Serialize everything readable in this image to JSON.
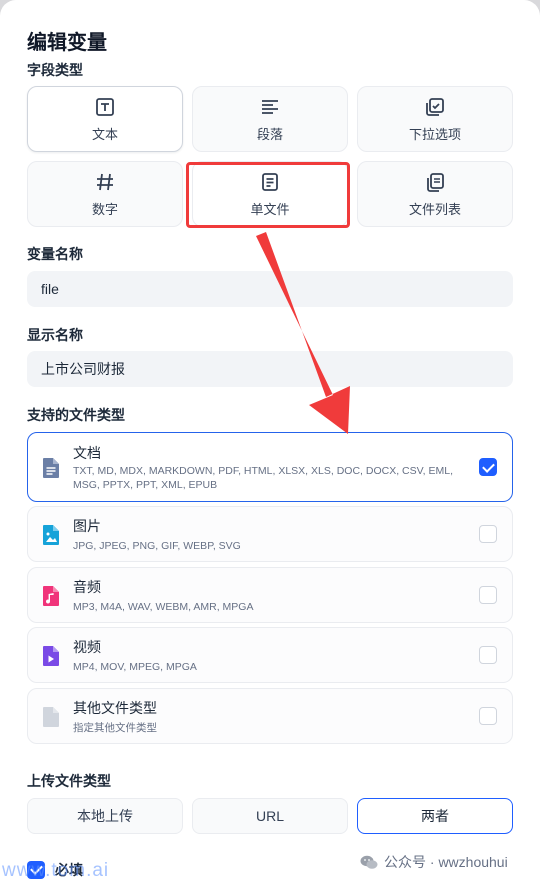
{
  "dialog": {
    "title": "编辑变量"
  },
  "field_type": {
    "label": "字段类型",
    "options": [
      {
        "label": "文本",
        "icon": "text-icon"
      },
      {
        "label": "段落",
        "icon": "paragraph-icon"
      },
      {
        "label": "下拉选项",
        "icon": "select-icon"
      },
      {
        "label": "数字",
        "icon": "number-icon"
      },
      {
        "label": "单文件",
        "icon": "file-icon"
      },
      {
        "label": "文件列表",
        "icon": "file-list-icon"
      }
    ],
    "selected": "单文件"
  },
  "variable_name": {
    "label": "变量名称",
    "value": "file"
  },
  "display_name": {
    "label": "显示名称",
    "value": "上市公司财报"
  },
  "file_types": {
    "label": "支持的文件类型",
    "items": [
      {
        "name": "文档",
        "exts": "TXT, MD, MDX, MARKDOWN, PDF, HTML, XLSX, XLS, DOC, DOCX, CSV, EML, MSG, PPTX, PPT, XML, EPUB",
        "checked": true,
        "color": "#6b7fa6"
      },
      {
        "name": "图片",
        "exts": "JPG, JPEG, PNG, GIF, WEBP, SVG",
        "checked": false,
        "color": "#16a3d9"
      },
      {
        "name": "音频",
        "exts": "MP3, M4A, WAV, WEBM, AMR, MPGA",
        "checked": false,
        "color": "#f0347a"
      },
      {
        "name": "视频",
        "exts": "MP4, MOV, MPEG, MPGA",
        "checked": false,
        "color": "#7a4ae6"
      },
      {
        "name": "其他文件类型",
        "exts": "指定其他文件类型",
        "checked": false,
        "color": "#d0d5dd"
      }
    ]
  },
  "upload_type": {
    "label": "上传文件类型",
    "options": [
      "本地上传",
      "URL",
      "两者"
    ],
    "selected": "两者"
  },
  "required": {
    "label": "必填",
    "checked": true
  },
  "watermark": {
    "url": "www.tom.ai",
    "wechat": "公众号 · wwzhouhui"
  },
  "colors": {
    "accent": "#1f5eff",
    "annotation_red": "#f03b3b"
  }
}
